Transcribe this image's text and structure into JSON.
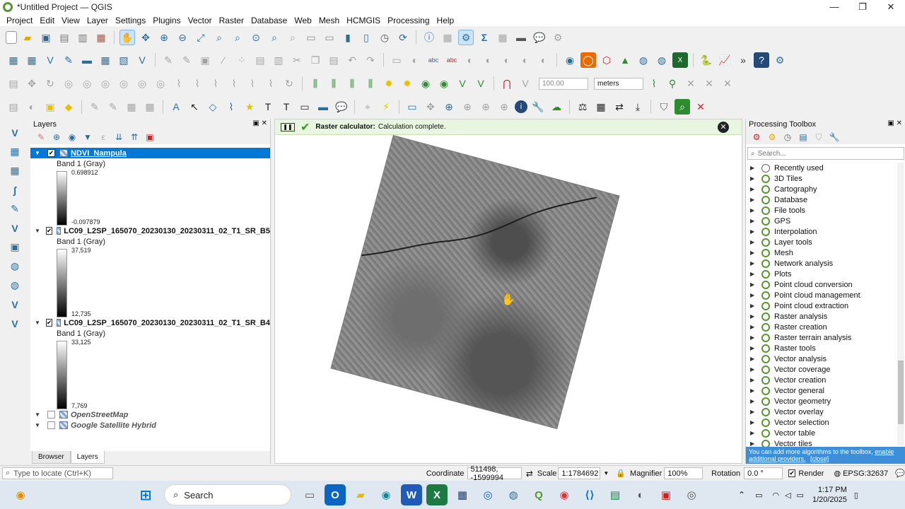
{
  "window": {
    "title": "*Untitled Project — QGIS",
    "minimize": "—",
    "maximize": "❐",
    "close": "✕"
  },
  "menu": [
    "Project",
    "Edit",
    "View",
    "Layer",
    "Settings",
    "Plugins",
    "Vector",
    "Raster",
    "Database",
    "Web",
    "Mesh",
    "HCMGIS",
    "Processing",
    "Help"
  ],
  "toolbar_snap": {
    "tolerance": "100.00",
    "units": "meters"
  },
  "layers_panel": {
    "title": "Layers",
    "tabs": [
      "Browser",
      "Layers"
    ],
    "active_tab": "Layers",
    "layers": [
      {
        "name": "NDVI_Nampula",
        "checked": true,
        "selected": true,
        "band": "Band 1 (Gray)",
        "max": "0.698912",
        "min": "-0.097879"
      },
      {
        "name": "LC09_L2SP_165070_20230130_20230311_02_T1_SR_B5",
        "checked": true,
        "selected": false,
        "band": "Band 1 (Gray)",
        "max": "37,519",
        "min": "12,735"
      },
      {
        "name": "LC09_L2SP_165070_20230130_20230311_02_T1_SR_B4",
        "checked": true,
        "selected": false,
        "band": "Band 1 (Gray)",
        "max": "33,125",
        "min": "7,769"
      },
      {
        "name": "OpenStreetMap",
        "checked": false,
        "selected": false
      },
      {
        "name": "Google Satellite Hybrid",
        "checked": false,
        "selected": false
      }
    ]
  },
  "message_bar": {
    "title": "Raster calculator:",
    "text": "Calculation complete."
  },
  "toolbox": {
    "title": "Processing Toolbox",
    "search_placeholder": "Search...",
    "items": [
      "Recently used",
      "3D Tiles",
      "Cartography",
      "Database",
      "File tools",
      "GPS",
      "Interpolation",
      "Layer tools",
      "Mesh",
      "Network analysis",
      "Plots",
      "Point cloud conversion",
      "Point cloud management",
      "Point cloud extraction",
      "Raster analysis",
      "Raster creation",
      "Raster terrain analysis",
      "Raster tools",
      "Vector analysis",
      "Vector coverage",
      "Vector creation",
      "Vector general",
      "Vector geometry",
      "Vector overlay",
      "Vector selection",
      "Vector table",
      "Vector tiles"
    ],
    "note_text": "You can add more algorithms to the toolbox,",
    "note_link": "enable additional providers.",
    "note_close": "[close]"
  },
  "statusbar": {
    "locate_placeholder": "Type to locate (Ctrl+K)",
    "coordinate_label": "Coordinate",
    "coordinate": "511498, -1599994",
    "scale_label": "Scale",
    "scale": "1:1784692",
    "magnifier_label": "Magnifier",
    "magnifier": "100%",
    "rotation_label": "Rotation",
    "rotation": "0.0 °",
    "render_label": "Render",
    "crs": "EPSG:32637"
  },
  "taskbar": {
    "search": "Search",
    "time": "1:17 PM",
    "date": "1/20/2025"
  },
  "colors": {
    "selection": "#0078d7",
    "qgis_green": "#589632",
    "message_bg": "#e8f6e0",
    "note_bg": "#3c8fd8"
  }
}
